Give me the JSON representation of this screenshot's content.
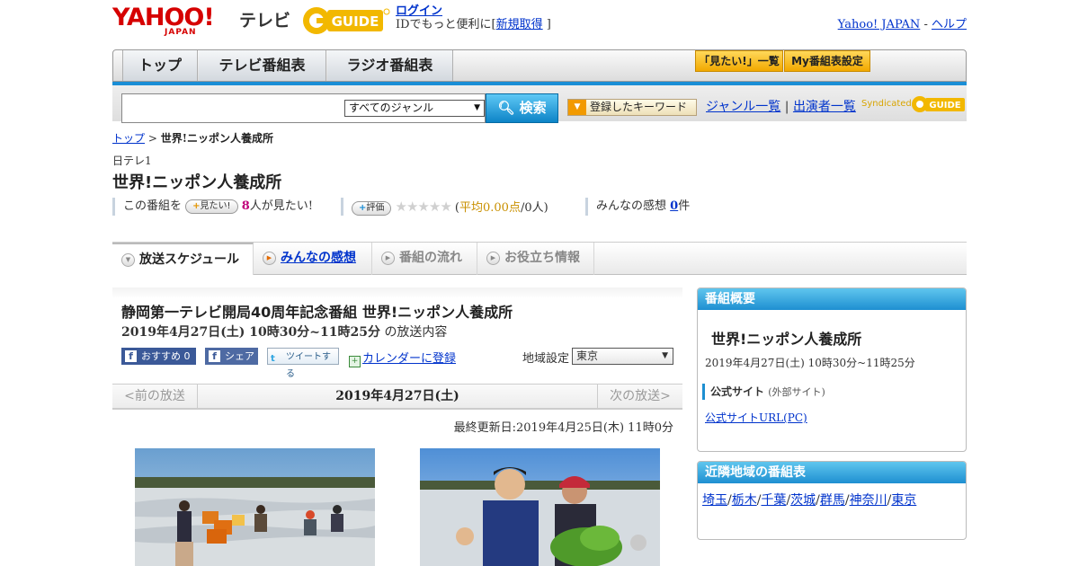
{
  "header": {
    "logo_yahoo": "YAHOO!",
    "logo_japan": "JAPAN",
    "logo_tv": "テレビ",
    "login": "ログイン",
    "login_msg_prefix": "IDでもっと便利に[",
    "login_register": "新規取得",
    "login_msg_suffix": "]",
    "yahoo_japan": "Yahoo! JAPAN",
    "link_sep": "-",
    "help": "ヘルプ"
  },
  "nav": {
    "tabs": [
      "トップ",
      "テレビ番組表",
      "ラジオ番組表"
    ],
    "want_list": "「見たい!」一覧",
    "my_settings": "My番組表設定"
  },
  "search": {
    "placeholder": "",
    "genre_selected": "すべてのジャンル",
    "button": "検索",
    "registered_kw": "登録したキーワード",
    "genre_list": "ジャンル一覧",
    "performer_list": "出演者一覧",
    "sep": "|",
    "syndicated": "Syndicated"
  },
  "breadcrumb": {
    "top": "トップ",
    "sep": ">",
    "current": "世界!ニッポン人養成所"
  },
  "program": {
    "channel": "日テレ1",
    "title": "世界!ニッポン人養成所"
  },
  "stats": {
    "prefix": "この番組を",
    "want_btn": "見たい!",
    "want_count": "8",
    "want_suffix": "人が見たい!",
    "rate_btn": "評価",
    "stars": "★★★★★",
    "avg_open": "(",
    "avg_label": "平均0.00点",
    "avg_people": "/0人)",
    "impressions_label": "みんなの感想",
    "impressions_count": "0",
    "impressions_unit": "件"
  },
  "tabs": [
    "放送スケジュール",
    "みんなの感想",
    "番組の流れ",
    "お役立ち情報"
  ],
  "main": {
    "title": "静岡第一テレビ開局40周年記念番組 世界!ニッポン人養成所",
    "date_time": "2019年4月27日(土) 10時30分~11時25分",
    "date_suffix": "の放送内容",
    "recommend": "おすすめ 0",
    "share": "シェア",
    "tweet": "ツイートする",
    "calendar": "カレンダーに登録",
    "region_label": "地域設定",
    "region_value": "東京",
    "prev": "<前の放送",
    "current_date": "2019年4月27日(土)",
    "next": "次の放送>",
    "updated": "最終更新日:2019年4月25日(木) 11時0分"
  },
  "side": {
    "summary_head": "番組概要",
    "summary_title": "世界!ニッポン人養成所",
    "summary_date": "2019年4月27日(土) 10時30分~11時25分",
    "official_label": "公式サイト",
    "official_note": "(外部サイト)",
    "official_url": "公式サイトURL(PC)",
    "neighbor_head": "近隣地域の番組表",
    "regions": [
      "埼玉",
      "栃木",
      "千葉",
      "茨城",
      "群馬",
      "神奈川",
      "東京"
    ],
    "region_sep": "/"
  },
  "colors": {
    "accent_blue": "#1a8ed6",
    "link": "#0033cc",
    "yahoo_red": "#d60000",
    "gguide_yellow": "#f2b800"
  }
}
